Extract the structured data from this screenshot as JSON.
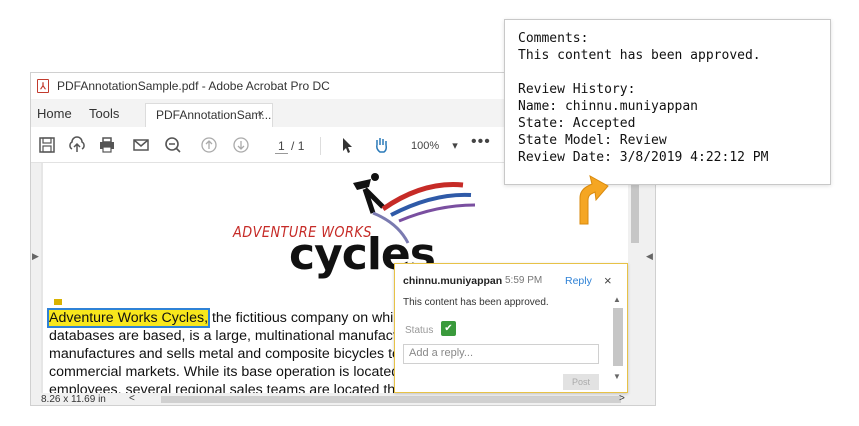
{
  "window": {
    "title": "PDFAnnotationSample.pdf - Adobe Acrobat Pro DC",
    "tabs": {
      "home": "Home",
      "tools": "Tools",
      "document": "PDFAnnotationSam...",
      "close": "×"
    }
  },
  "toolbar": {
    "page_current": "1",
    "page_sep": "/ 1",
    "zoom": "100%",
    "zoom_arrow": "▾",
    "more": "•••",
    "icons": [
      "save-icon",
      "upload-icon",
      "print-icon",
      "mail-icon",
      "zoom-out-icon",
      "page-up-icon",
      "page-down-icon",
      "pointer-icon",
      "hand-icon"
    ]
  },
  "document": {
    "logo": {
      "line1": "ADVENTURE WORKS",
      "line2": "cycles"
    },
    "highlighted": "Adventure Works Cycles,",
    "lines": [
      " the fictitious company on which",
      "databases are based, is a large, multinational manufactu",
      "manufactures and sells metal and composite bicycles to",
      "commercial markets. While its base operation is located i",
      "employees, several regional sales teams are located thro"
    ]
  },
  "statusbar": {
    "page_size": "8.26 x 11.69 in",
    "left_arrow": "<",
    "right_arrow": ">"
  },
  "comment": {
    "author": "chinnu.muniyappan",
    "time": "5:59 PM",
    "reply_link": "Reply",
    "close": "×",
    "text": "This content has been approved.",
    "status_label": "Status",
    "reply_placeholder": "Add a reply...",
    "post_label": "Post"
  },
  "tooltip": {
    "lines": [
      "Comments:",
      "This content has been approved.",
      "",
      "Review History:",
      "Name: chinnu.muniyappan",
      "State: Accepted",
      "State Model: Review",
      "Review Date: 3/8/2019 4:22:12 PM"
    ]
  },
  "colors": {
    "accent": "#2f82d6",
    "highlight": "#f8e71c",
    "arrow": "#f5a623",
    "approve": "#3a9a3c"
  }
}
